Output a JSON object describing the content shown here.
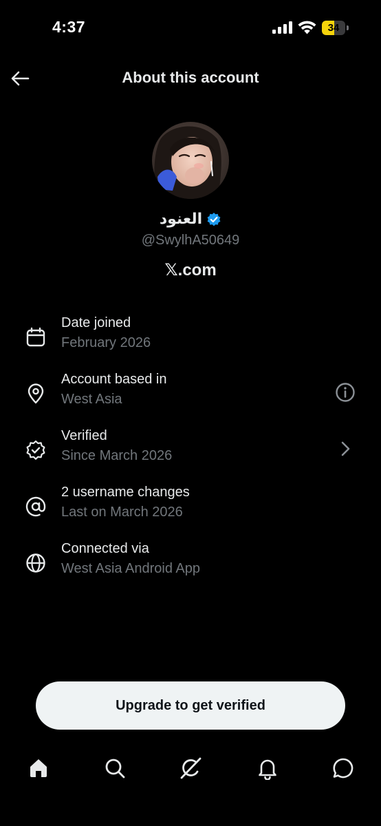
{
  "status_bar": {
    "time": "4:37",
    "battery_level": "34",
    "battery_fraction": 0.34,
    "battery_color": "#f5d30b"
  },
  "header": {
    "title": "About this account",
    "back_icon": "arrow-left-icon"
  },
  "profile": {
    "display_name": "العنود",
    "verified_badge_color": "#1d9bf0",
    "handle": "@SwylhA50649",
    "site": "𝕏.com"
  },
  "info_items": [
    {
      "icon": "calendar-icon",
      "label": "Date joined",
      "value": "February 2026",
      "trailing": ""
    },
    {
      "icon": "location-pin-icon",
      "label": "Account based in",
      "value": "West Asia",
      "trailing": "info-icon"
    },
    {
      "icon": "verified-seal-icon",
      "label": "Verified",
      "value": "Since March 2026",
      "trailing": "chevron-right-icon"
    },
    {
      "icon": "at-sign-icon",
      "label": "2 username changes",
      "value": "Last on March 2026",
      "trailing": ""
    },
    {
      "icon": "globe-icon",
      "label": "Connected via",
      "value": "West Asia Android App",
      "trailing": ""
    }
  ],
  "upgrade_button": {
    "label": "Upgrade to get verified"
  },
  "bottom_nav": {
    "items": [
      "home-icon",
      "search-icon",
      "grok-icon",
      "notifications-icon",
      "messages-icon"
    ],
    "active": "home-icon"
  },
  "colors": {
    "background": "#000000",
    "primary_text": "#e7e9ea",
    "secondary_text": "#71767b",
    "button_bg": "#eff3f4"
  }
}
